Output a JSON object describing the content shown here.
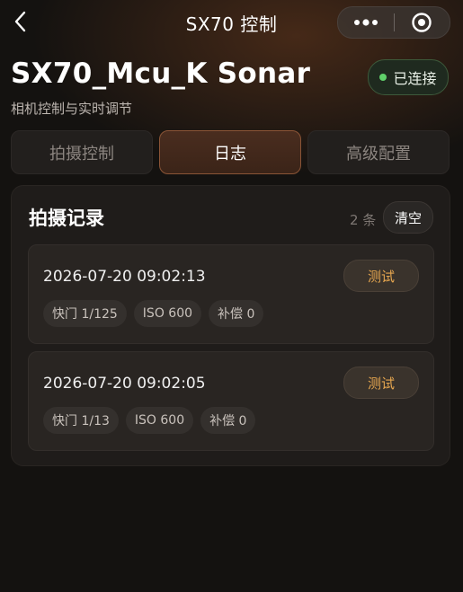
{
  "nav": {
    "title": "SX70 控制"
  },
  "device": {
    "name": "SX70_Mcu_K Sonar",
    "subtitle": "相机控制与实时调节",
    "status": "已连接"
  },
  "tabs": [
    {
      "label": "拍摄控制",
      "active": false
    },
    {
      "label": "日志",
      "active": true
    },
    {
      "label": "高级配置",
      "active": false
    }
  ],
  "log": {
    "title": "拍摄记录",
    "count": "2 条",
    "clear_label": "清空",
    "records": [
      {
        "time": "2026-07-20 09:02:13",
        "button": "测试",
        "shutter": "快门 1/125",
        "iso": "ISO 600",
        "comp": "补偿 0"
      },
      {
        "time": "2026-07-20 09:02:05",
        "button": "测试",
        "shutter": "快门 1/13",
        "iso": "ISO 600",
        "comp": "补偿 0"
      }
    ]
  },
  "colors": {
    "accent": "#e6a64f",
    "status_green": "#5fd06a",
    "tab_active_border": "#8a5436"
  }
}
